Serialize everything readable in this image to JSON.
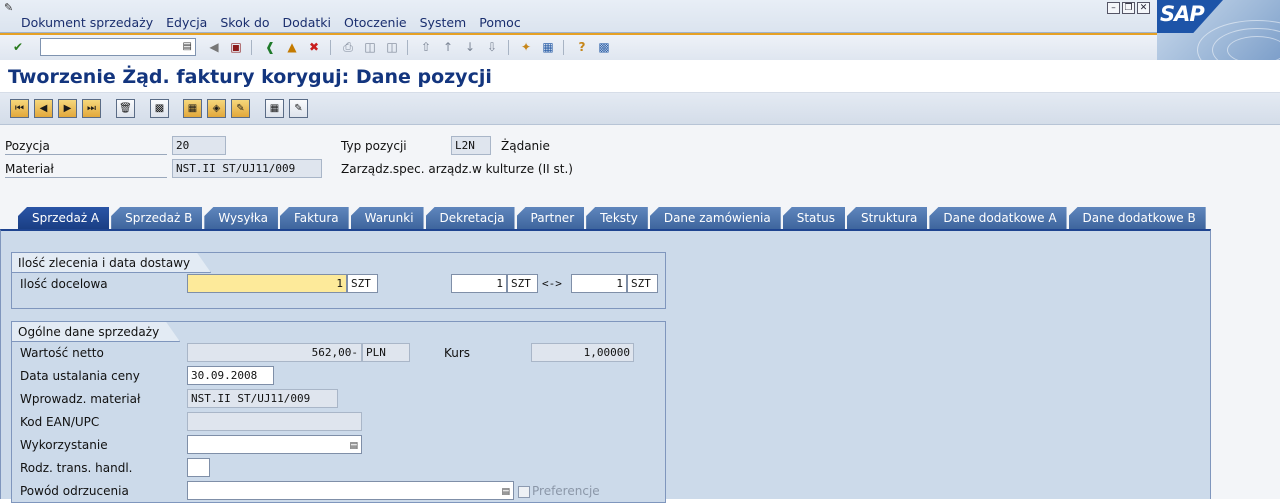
{
  "menu": {
    "items": [
      "Dokument sprzedaży",
      "Edycja",
      "Skok do",
      "Dodatki",
      "Otoczenie",
      "System",
      "Pomoc"
    ]
  },
  "logo": {
    "text": "SAP"
  },
  "toolbar": {
    "command_value": "",
    "icons": [
      "enter-icon",
      "back-icon",
      "save-icon",
      "exit-icon",
      "cancel-icon",
      "print-icon",
      "find-icon",
      "find-next-icon",
      "first-page-icon",
      "prev-page-icon",
      "next-page-icon",
      "last-page-icon",
      "new-session-icon",
      "shortcut-icon",
      "help-icon",
      "layout-icon"
    ]
  },
  "title": "Tworzenie Żąd. faktury koryguj: Dane pozycji",
  "header": {
    "pozycja_label": "Pozycja",
    "pozycja_value": "20",
    "typ_label": "Typ pozycji",
    "typ_value": "L2N",
    "typ_text": "Żądanie",
    "material_label": "Materiał",
    "material_value": "NST.II ST/UJ11/009",
    "material_text": "Zarządz.spec. arządz.w kulturze (II st.)"
  },
  "tabs": [
    "Sprzedaż A",
    "Sprzedaż B",
    "Wysyłka",
    "Faktura",
    "Warunki",
    "Dekretacja",
    "Partner",
    "Teksty",
    "Dane zamówienia",
    "Status",
    "Struktura",
    "Dane dodatkowe A",
    "Dane dodatkowe B"
  ],
  "group1": {
    "title": "Ilość zlecenia i data dostawy",
    "ilosc_label": "Ilość docelowa",
    "ilosc_value": "1",
    "ilosc_unit": "SZT",
    "conv_left_value": "1",
    "conv_left_unit": "SZT",
    "conv_arrow": "<->",
    "conv_right_value": "1",
    "conv_right_unit": "SZT"
  },
  "group2": {
    "title": "Ogólne dane sprzedaży",
    "netto_label": "Wartość netto",
    "netto_value": "562,00-",
    "netto_currency": "PLN",
    "kurs_label": "Kurs",
    "kurs_value": "1,00000",
    "data_label": "Data ustalania ceny",
    "data_value": "30.09.2008",
    "wprow_label": "Wprowadz. materiał",
    "wprow_value": "NST.II ST/UJ11/009",
    "ean_label": "Kod EAN/UPC",
    "ean_value": "",
    "wykorz_label": "Wykorzystanie",
    "wykorz_value": "",
    "rodz_label": "Rodz. trans. handl.",
    "rodz_value": "",
    "powod_label": "Powód odrzucenia",
    "powod_value": "",
    "pref_label": "Preferencje"
  }
}
